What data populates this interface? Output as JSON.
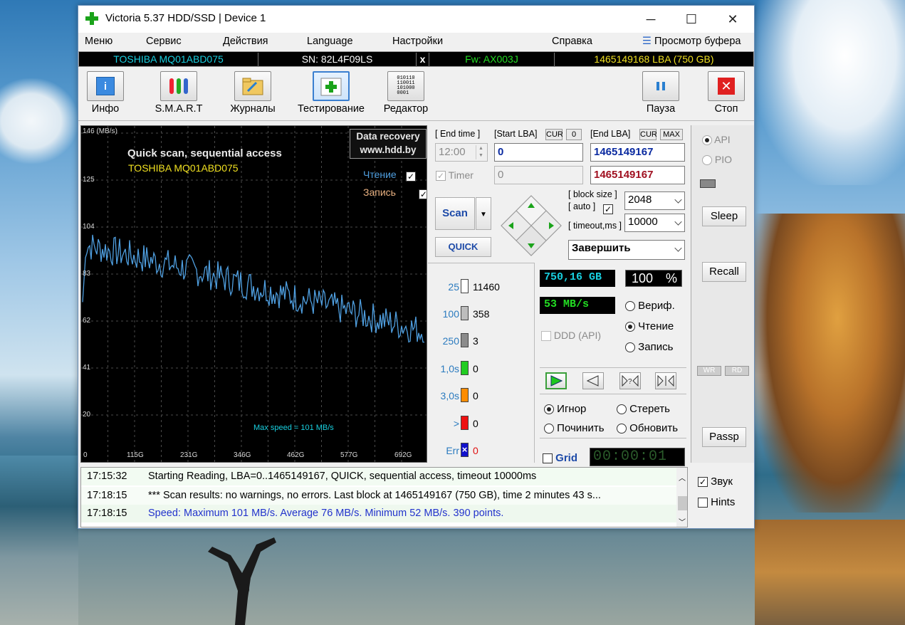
{
  "window": {
    "title": "Victoria 5.37 HDD/SSD | Device 1",
    "minimize": "─",
    "maximize": "☐",
    "close": "✕"
  },
  "menu": [
    "Меню",
    "Сервис",
    "Действия",
    "Language",
    "Настройки",
    "Справка"
  ],
  "menu_buffer": "Просмотр буфера",
  "infobar": {
    "model": "TOSHIBA MQ01ABD075",
    "serial": "SN: 82L4F09LS",
    "close": "x",
    "firmware": "Fw: AX003J",
    "capacity": "1465149168 LBA (750 GB)"
  },
  "toolbar": {
    "info": "Инфо",
    "smart": "S.M.A.R.T",
    "logs": "Журналы",
    "testing": "Тестирование",
    "editor": "Редактор",
    "pause": "Пауза",
    "stop": "Стоп",
    "editor_icon_text": "010110\n110011\n101000\n0001"
  },
  "graph": {
    "y_ticks": [
      "146 (MB/s)",
      "125",
      "104",
      "83",
      "62",
      "41",
      "20",
      "0"
    ],
    "x_ticks": [
      "115G",
      "231G",
      "346G",
      "462G",
      "577G",
      "692G"
    ],
    "title": "Quick scan, sequential access",
    "drive": "TOSHIBA MQ01ABD075",
    "badge_line1": "Data recovery",
    "badge_line2": "www.hdd.by",
    "legend_read": "Чтение",
    "legend_write": "Запись",
    "max_speed": "Max speed = 101 MB/s"
  },
  "params": {
    "end_time_label": "[ End time ]",
    "start_lba_label": "[Start LBA]",
    "cur": "CUR",
    "zero": "0",
    "end_lba_label": "[End LBA]",
    "max": "MAX",
    "end_time": "12:00",
    "start_lba": "0",
    "end_lba": "1465149167",
    "timer_label": "Timer",
    "timer_value": "0",
    "end_lba_red": "1465149167",
    "block_size_label": "[ block size ]",
    "auto_label": "[ auto ]",
    "block_size": "2048",
    "timeout_label": "[ timeout,ms ]",
    "timeout": "10000",
    "scan": "Scan",
    "quick": "QUICK",
    "finish": "Завершить"
  },
  "counters": [
    {
      "label": "25",
      "value": "11460",
      "color": "#ffffff"
    },
    {
      "label": "100",
      "value": "358",
      "color": "#bdbdbd"
    },
    {
      "label": "250",
      "value": "3",
      "color": "#8c8c8c"
    },
    {
      "label": "1,0s",
      "value": "0",
      "color": "#22cc22"
    },
    {
      "label": "3,0s",
      "value": "0",
      "color": "#ff8c00"
    },
    {
      "label": ">",
      "value": "0",
      "color": "#ee1111"
    },
    {
      "label": "Err",
      "value": "0",
      "color": "#1111cc"
    }
  ],
  "stats": {
    "size": "750,16 GB",
    "percent": "100",
    "percent_sign": "%",
    "speed": "53 MB/s",
    "ddd": "DDD (API)",
    "verify": "Вериф.",
    "read": "Чтение",
    "write": "Запись",
    "ignore": "Игнор",
    "erase": "Стереть",
    "repair": "Починить",
    "refresh": "Обновить",
    "grid": "Grid",
    "timer": "00:00:01"
  },
  "right": {
    "api": "API",
    "pio": "PIO",
    "sleep": "Sleep",
    "recall": "Recall",
    "wr": "WR",
    "rd": "RD",
    "passp": "Passp",
    "sound": "Звук",
    "hints": "Hints"
  },
  "log": [
    {
      "time": "17:15:32",
      "msg": "Starting Reading, LBA=0..1465149167, QUICK, sequential access, timeout 10000ms"
    },
    {
      "time": "17:18:15",
      "msg": "*** Scan results: no warnings, no errors. Last block at 1465149167 (750 GB), time 2 minutes 43 s..."
    },
    {
      "time": "17:18:15",
      "msg": "Speed: Maximum 101 MB/s. Average 76 MB/s. Minimum 52 MB/s. 390 points."
    }
  ],
  "colors": {
    "accent_cyan": "#18d0e0",
    "graph_line": "#4f9fe0",
    "counter_label": "#2b7bbf",
    "speed_log": "#2233cc",
    "end_lba_red": "#a01020"
  }
}
